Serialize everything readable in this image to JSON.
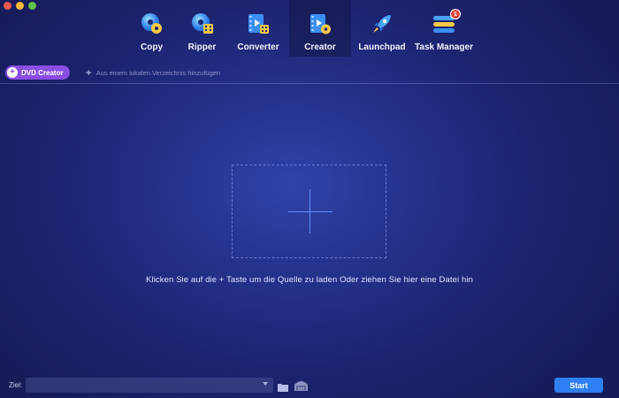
{
  "window": {
    "controls": [
      "close",
      "minimize",
      "maximize"
    ]
  },
  "nav": {
    "items": [
      {
        "label": "Copy",
        "icon": "disc-copy-icon"
      },
      {
        "label": "Ripper",
        "icon": "disc-ripper-icon"
      },
      {
        "label": "Converter",
        "icon": "film-converter-icon"
      },
      {
        "label": "Creator",
        "icon": "film-creator-icon",
        "active": true
      },
      {
        "label": "Launchpad",
        "icon": "rocket-icon"
      },
      {
        "label": "Task Manager",
        "icon": "task-list-icon",
        "badge": "1"
      }
    ]
  },
  "toolbar": {
    "mode_label": "DVD Creator",
    "add_local_label": "Aus einem lokalen Verzeichnis hinzufügen"
  },
  "dropzone": {
    "hint": "Klicken Sie auf die + Taste um die Quelle zu laden Oder ziehen Sie hier eine Datei hin"
  },
  "bottom": {
    "target_label": "Ziel:",
    "target_value": "",
    "start_label": "Start"
  },
  "colors": {
    "accent": "#2f7ff5",
    "mode_pill": "#8a4de6",
    "badge": "#e8453c",
    "background": "#1c2470"
  }
}
